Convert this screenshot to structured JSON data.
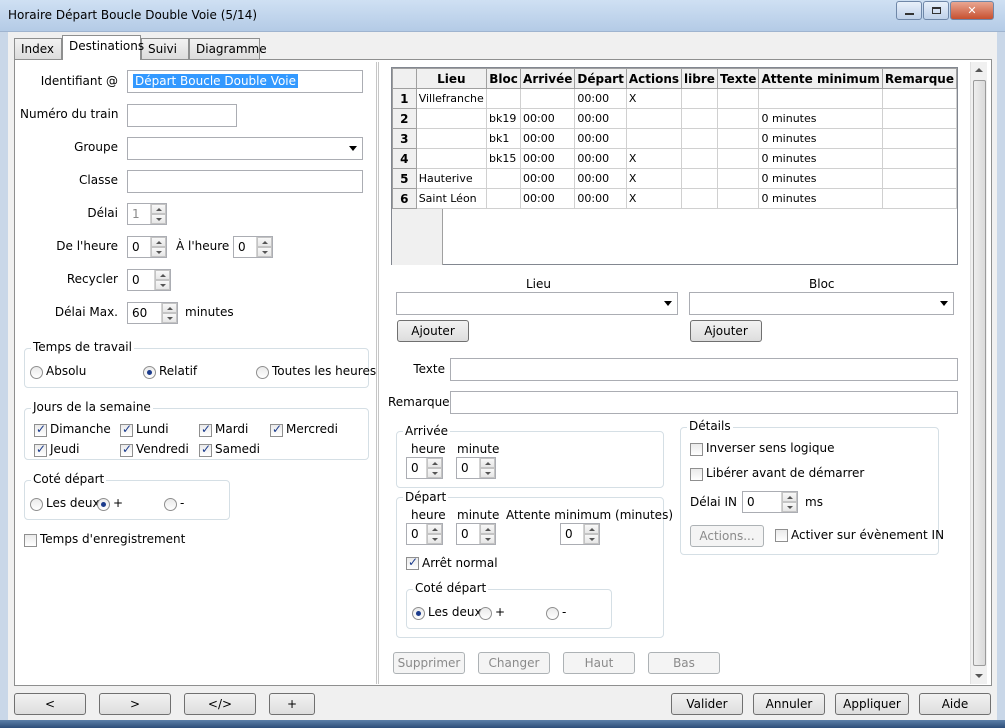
{
  "window": {
    "title": "Horaire Départ Boucle Double Voie (5/14)",
    "close_glyph": "✕"
  },
  "tabs": [
    "Index",
    "Destinations",
    "Suivi",
    "Diagramme"
  ],
  "form": {
    "identifiant_label": "Identifiant @",
    "identifiant_value": "Départ Boucle Double Voie",
    "numero_label": "Numéro du train",
    "numero_value": "",
    "groupe_label": "Groupe",
    "groupe_value": "",
    "classe_label": "Classe",
    "classe_value": "",
    "delai_label": "Délai",
    "delai_value": "1",
    "de_heure_label": "De l'heure",
    "de_heure_value": "0",
    "a_heure_label": "À l'heure",
    "a_heure_value": "0",
    "recycler_label": "Recycler",
    "recycler_value": "0",
    "delai_max_label": "Délai Max.",
    "delai_max_value": "60",
    "delai_max_unit": "minutes"
  },
  "temps_travail": {
    "title": "Temps de travail",
    "options": [
      "Absolu",
      "Relatif",
      "Toutes les heures"
    ],
    "selected": "Relatif"
  },
  "jours": {
    "title": "Jours de la semaine",
    "days": [
      {
        "label": "Dimanche",
        "checked": true
      },
      {
        "label": "Lundi",
        "checked": true
      },
      {
        "label": "Mardi",
        "checked": true
      },
      {
        "label": "Mercredi",
        "checked": true
      },
      {
        "label": "Jeudi",
        "checked": true
      },
      {
        "label": "Vendredi",
        "checked": true
      },
      {
        "label": "Samedi",
        "checked": true
      }
    ]
  },
  "cote_depart_left": {
    "title": "Coté départ",
    "options": [
      "Les deux",
      "+",
      "-"
    ],
    "selected": "+"
  },
  "temps_enregistrement": {
    "label": "Temps d'enregistrement",
    "checked": false
  },
  "table": {
    "columns": [
      "Lieu",
      "Bloc",
      "Arrivée",
      "Départ",
      "Actions",
      "libre",
      "Texte",
      "Attente minimum",
      "Remarque"
    ],
    "rows": [
      {
        "num": "1",
        "lieu": "Villefranche",
        "bloc": "",
        "arrivee": "",
        "depart": "00:00",
        "actions": "X",
        "libre": "",
        "texte": "",
        "attente": "",
        "remarque": ""
      },
      {
        "num": "2",
        "lieu": "",
        "bloc": "bk19",
        "arrivee": "00:00",
        "depart": "00:00",
        "actions": "",
        "libre": "",
        "texte": "",
        "attente": "0 minutes",
        "remarque": ""
      },
      {
        "num": "3",
        "lieu": "",
        "bloc": "bk1",
        "arrivee": "00:00",
        "depart": "00:00",
        "actions": "",
        "libre": "",
        "texte": "",
        "attente": "0 minutes",
        "remarque": ""
      },
      {
        "num": "4",
        "lieu": "",
        "bloc": "bk15",
        "arrivee": "00:00",
        "depart": "00:00",
        "actions": "X",
        "libre": "",
        "texte": "",
        "attente": "0 minutes",
        "remarque": ""
      },
      {
        "num": "5",
        "lieu": "Hauterive",
        "bloc": "",
        "arrivee": "00:00",
        "depart": "00:00",
        "actions": "X",
        "libre": "",
        "texte": "",
        "attente": "0 minutes",
        "remarque": ""
      },
      {
        "num": "6",
        "lieu": "Saint Léon",
        "bloc": "",
        "arrivee": "00:00",
        "depart": "00:00",
        "actions": "X",
        "libre": "",
        "texte": "",
        "attente": "0 minutes",
        "remarque": ""
      }
    ]
  },
  "lieu_section": {
    "label": "Lieu",
    "value": "",
    "add_label": "Ajouter"
  },
  "bloc_section": {
    "label": "Bloc",
    "value": "",
    "add_label": "Ajouter"
  },
  "texte": {
    "label": "Texte",
    "value": ""
  },
  "remarque": {
    "label": "Remarque",
    "value": ""
  },
  "arrivee": {
    "title": "Arrivée",
    "heure_label": "heure",
    "heure_value": "0",
    "minute_label": "minute",
    "minute_value": "0"
  },
  "depart": {
    "title": "Départ",
    "heure_label": "heure",
    "heure_value": "0",
    "minute_label": "minute",
    "minute_value": "0",
    "attente_label": "Attente minimum (minutes)",
    "attente_value": "0",
    "arret_label": "Arrêt normal",
    "arret_checked": true,
    "cote_title": "Coté départ",
    "cote_options": [
      "Les deux",
      "+",
      "-"
    ],
    "cote_selected": "Les deux"
  },
  "details": {
    "title": "Détails",
    "inverser_label": "Inverser sens logique",
    "inverser_checked": false,
    "liberer_label": "Libérer avant de démarrer",
    "liberer_checked": false,
    "delai_in_label": "Délai IN",
    "delai_in_value": "0",
    "delai_in_unit": "ms",
    "actions_label": "Actions...",
    "activer_label": "Activer sur évènement IN",
    "activer_checked": false
  },
  "row_buttons": [
    "Supprimer",
    "Changer",
    "Haut",
    "Bas"
  ],
  "nav_buttons": [
    "<",
    ">",
    "</>",
    "+"
  ],
  "dialog_buttons": [
    "Valider",
    "Annuler",
    "Appliquer",
    "Aide"
  ]
}
